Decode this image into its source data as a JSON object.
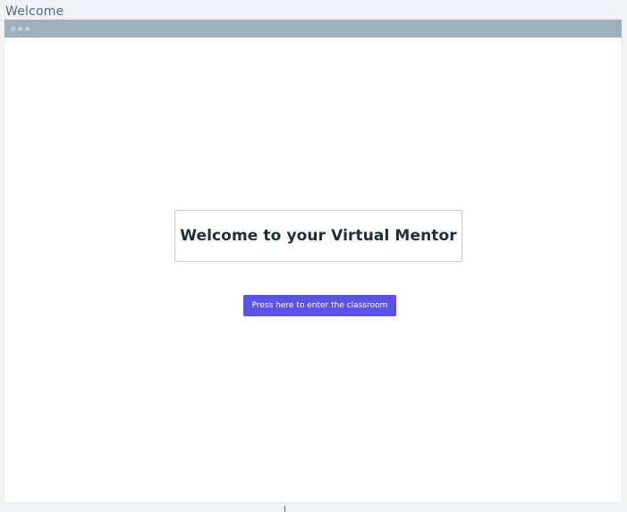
{
  "page": {
    "label": "Welcome"
  },
  "window": {
    "titlebar_color": "#9fb0bd",
    "background": "#ffffff"
  },
  "welcome": {
    "title": "Welcome to your Virtual Mentor"
  },
  "enter_button": {
    "label": "Press here to enter the classroom",
    "color": "#5b52e6"
  }
}
